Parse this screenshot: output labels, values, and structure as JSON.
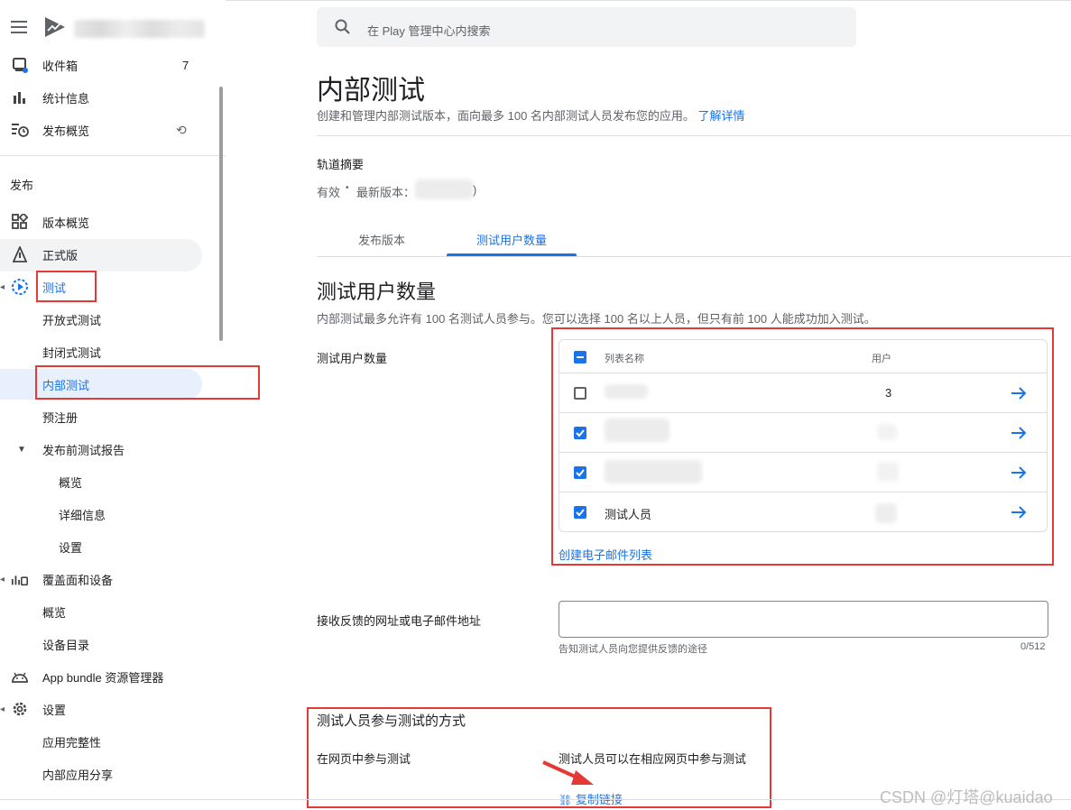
{
  "sidebar": {
    "inbox": {
      "label": "收件箱",
      "count": "7"
    },
    "stats": {
      "label": "统计信息"
    },
    "publishing": {
      "label": "发布概览"
    },
    "section": "发布",
    "items": [
      {
        "label": "版本概览"
      },
      {
        "label": "正式版"
      },
      {
        "label": "测试"
      },
      {
        "label": "开放式测试"
      },
      {
        "label": "封闭式测试"
      },
      {
        "label": "内部测试"
      },
      {
        "label": "预注册"
      },
      {
        "label": "发布前测试报告"
      },
      {
        "label": "概览"
      },
      {
        "label": "详细信息"
      },
      {
        "label": "设置"
      },
      {
        "label": "覆盖面和设备"
      },
      {
        "label": "概览"
      },
      {
        "label": "设备目录"
      },
      {
        "label": "App bundle 资源管理器"
      },
      {
        "label": "设置"
      },
      {
        "label": "应用完整性"
      },
      {
        "label": "内部应用分享"
      }
    ]
  },
  "search": {
    "placeholder": "在 Play 管理中心内搜索"
  },
  "page": {
    "title": "内部测试",
    "subtitle": "创建和管理内部测试版本，面向最多 100 名内部测试人员发布您的应用。",
    "learn_more": "了解详情"
  },
  "track_summary": {
    "heading": "轨道摘要",
    "status": "有效",
    "latest_label": "最新版本：",
    "latest_suffix": ")"
  },
  "tabs": [
    {
      "label": "发布版本",
      "active": false
    },
    {
      "label": "测试用户数量",
      "active": true
    }
  ],
  "testers": {
    "title": "测试用户数量",
    "desc": "内部测试最多允许有 100 名测试人员参与。您可以选择 100 名以上人员，但只有前 100 人能成功加入测试。",
    "field_label": "测试用户数量",
    "col_name": "列表名称",
    "col_users": "用户",
    "rows": [
      {
        "name": "",
        "users": "3",
        "checked": false
      },
      {
        "name": "",
        "users": "",
        "checked": true
      },
      {
        "name": "",
        "users": "",
        "checked": true
      },
      {
        "name": "测试人员",
        "users": "",
        "checked": true
      }
    ],
    "create_list": "创建电子邮件列表"
  },
  "feedback": {
    "label": "接收反馈的网址或电子邮件地址",
    "value": "",
    "helper": "告知测试人员向您提供反馈的途径",
    "counter": "0/512"
  },
  "join": {
    "title": "测试人员参与测试的方式",
    "web_label": "在网页中参与测试",
    "web_desc": "测试人员可以在相应网页中参与测试",
    "copy_link": "复制链接"
  },
  "watermark": "CSDN @灯塔@kuaidao",
  "colors": {
    "accent": "#1a73e8",
    "annotation": "#e53935"
  }
}
